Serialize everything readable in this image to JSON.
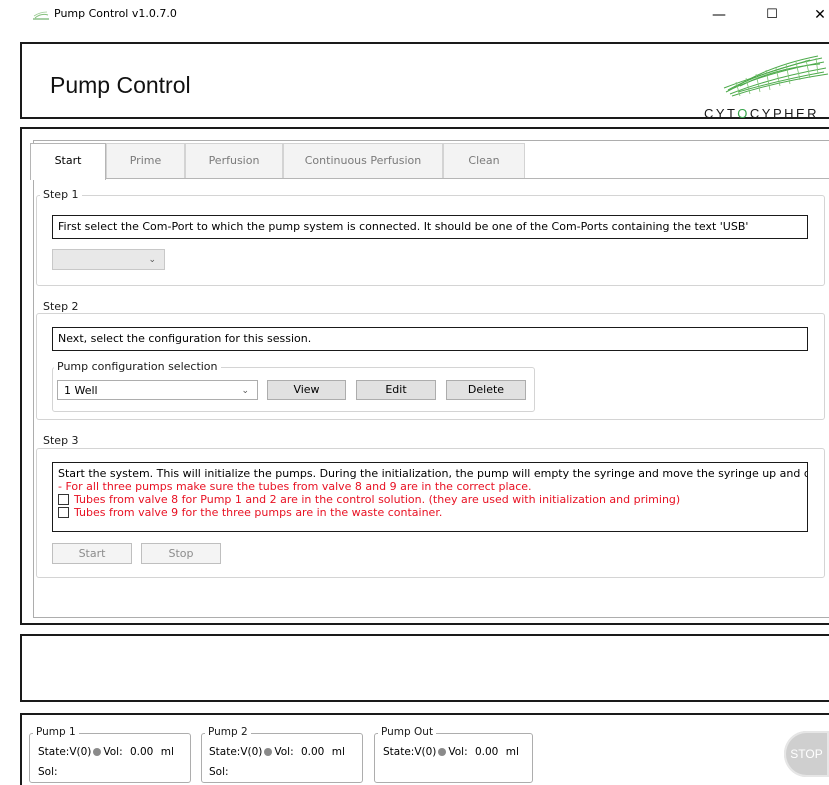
{
  "window": {
    "title": "Pump Control v1.0.7.0",
    "minimize_glyph": "—",
    "maximize_glyph": "☐",
    "close_glyph": "✕"
  },
  "header": {
    "title": "Pump Control",
    "logo_text_pre": "CYT",
    "logo_text_o": "O",
    "logo_text_post": "CYPHER",
    "logo_accent": "#37a34a"
  },
  "tabs": [
    {
      "label": "Start",
      "active": true
    },
    {
      "label": "Prime",
      "active": false
    },
    {
      "label": "Perfusion",
      "active": false
    },
    {
      "label": "Continuous Perfusion",
      "active": false
    },
    {
      "label": "Clean",
      "active": false
    }
  ],
  "step1": {
    "legend": "Step 1",
    "instruction": "First select the Com-Port to which the pump system is connected. It should be one of the Com-Ports containing the text 'USB'",
    "com_port_value": ""
  },
  "step2": {
    "legend": "Step 2",
    "instruction": "Next, select the configuration for this session.",
    "config_legend": "Pump configuration selection",
    "config_value": "1 Well",
    "view_label": "View",
    "edit_label": "Edit",
    "delete_label": "Delete"
  },
  "step3": {
    "legend": "Step 3",
    "instruction": "Start the system. This will initialize the pumps. During the initialization, the pump will empty the syringe and move the syringe up and down.",
    "warning": "- For all three pumps make sure the tubes from valve 8 and 9 are in the correct place.",
    "check1_label": "Tubes from valve 8 for Pump 1 and 2 are in the control solution. (they are used with initialization and priming)",
    "check2_label": "Tubes from valve 9 for the three pumps are in the waste container.",
    "start_label": "Start",
    "stop_label": "Stop"
  },
  "pumps": [
    {
      "name": "Pump 1",
      "state": "State:V(0)",
      "vol_label": "Vol:",
      "vol_value": "0.00",
      "unit": "ml",
      "sol_label": "Sol:"
    },
    {
      "name": "Pump 2",
      "state": "State:V(0)",
      "vol_label": "Vol:",
      "vol_value": "0.00",
      "unit": "ml",
      "sol_label": "Sol:"
    },
    {
      "name": "Pump Out",
      "state": "State:V(0)",
      "vol_label": "Vol:",
      "vol_value": "0.00",
      "unit": "ml"
    }
  ],
  "stop_button": "STOP",
  "colors": {
    "warning": "#e81123",
    "status_dot": "#8a8a8a"
  }
}
